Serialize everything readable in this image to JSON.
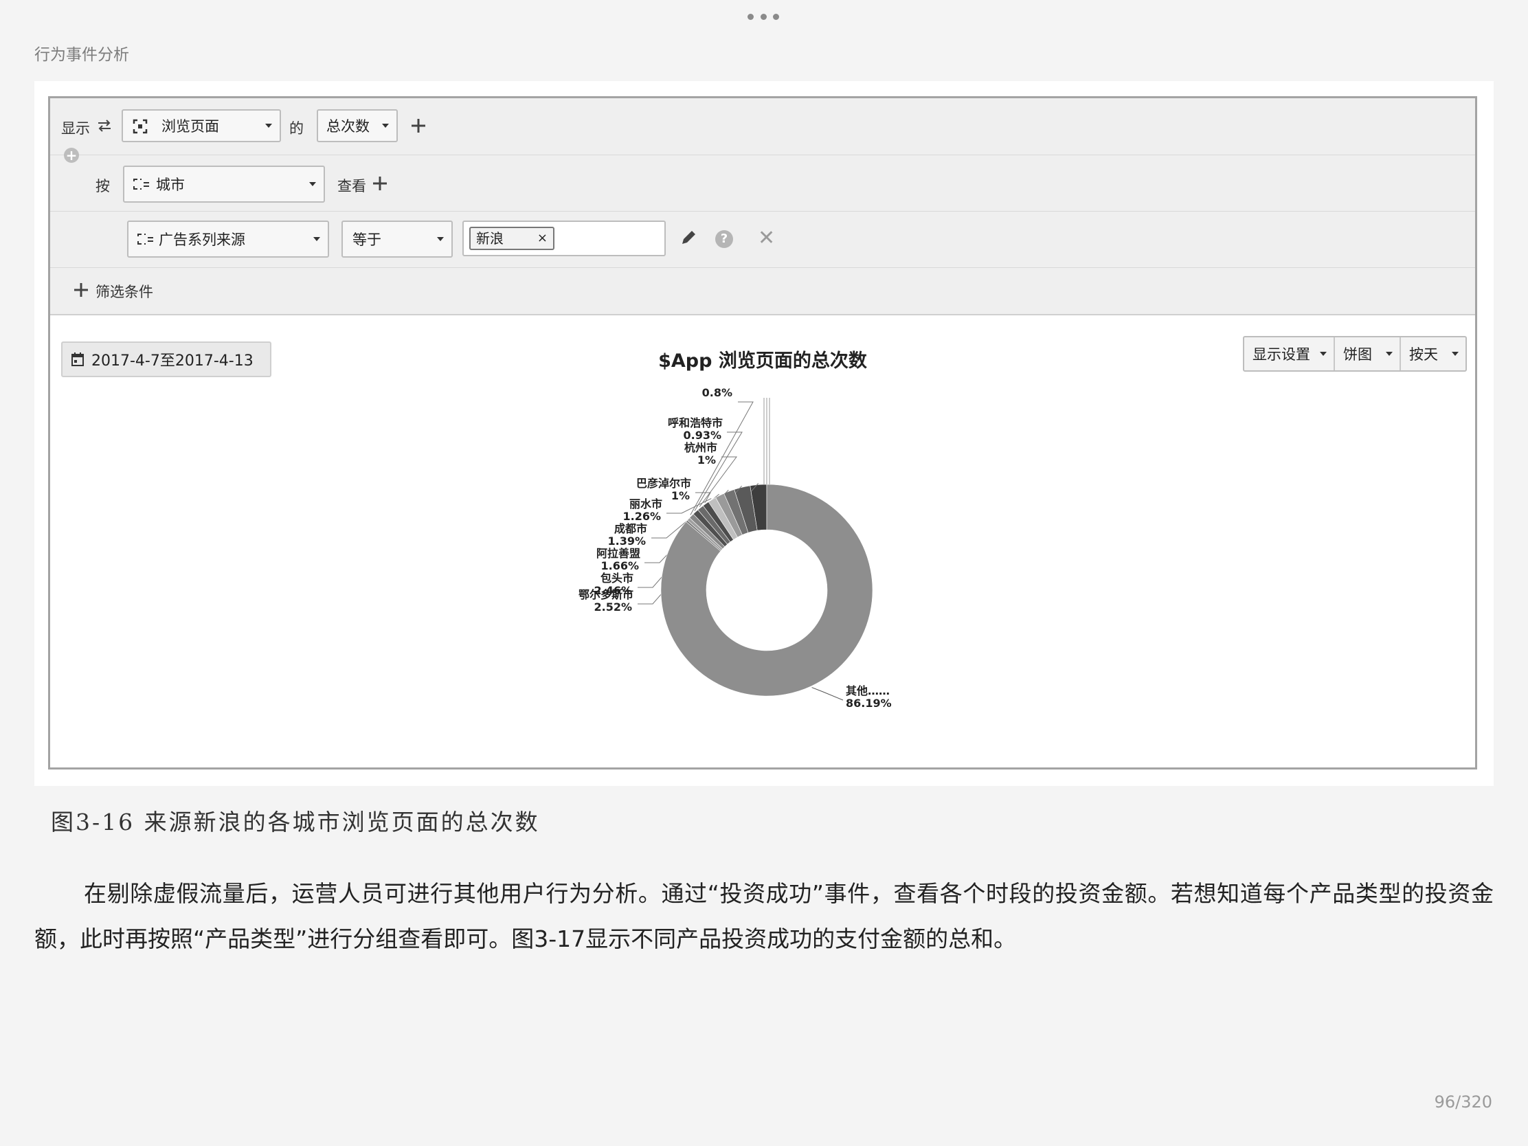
{
  "header": {
    "book_title": "行为事件分析"
  },
  "query": {
    "show_label": "显示",
    "event": "浏览页面",
    "of_label": "的",
    "metric": "总次数",
    "by_label": "按",
    "group_by": "城市",
    "view_label": "查看",
    "filter_property": "广告系列来源",
    "operator": "等于",
    "filter_value": "新浪",
    "add_filter_label": "筛选条件"
  },
  "toolbar": {
    "date_range": "2017-4-7至2017-4-13",
    "display_settings": "显示设置",
    "chart_type": "饼图",
    "granularity": "按天"
  },
  "chart_data": {
    "type": "pie",
    "donut": true,
    "title": "$App 浏览页面的总次数",
    "slices": [
      {
        "label": "鄂尔多斯市",
        "value": 2.52,
        "display": "2.52%"
      },
      {
        "label": "包头市",
        "value": 2.46,
        "display": "2.46%"
      },
      {
        "label": "阿拉善盟",
        "value": 1.66,
        "display": "1.66%"
      },
      {
        "label": "成都市",
        "value": 1.39,
        "display": "1.39%"
      },
      {
        "label": "丽水市",
        "value": 1.26,
        "display": "1.26%"
      },
      {
        "label": "巴彦淖尔市",
        "value": 1.0,
        "display": "1%"
      },
      {
        "label": "杭州市",
        "value": 1.0,
        "display": "1%"
      },
      {
        "label": "呼和浩特市",
        "value": 0.93,
        "display": "0.93%"
      },
      {
        "label": "",
        "value": 0.8,
        "display": "0.8%"
      },
      {
        "label": "",
        "value": 0.5,
        "display": ""
      },
      {
        "label": "",
        "value": 0.29,
        "display": ""
      },
      {
        "label": "其他……",
        "value": 86.19,
        "display": "86.19%"
      }
    ],
    "colors": [
      "#3e3e3e",
      "#5a5a5a",
      "#727272",
      "#9a9a9a",
      "#bfbfbf",
      "#4c4c4c",
      "#6a6a6a",
      "#505050",
      "#888888",
      "#a0a0a0",
      "#777777",
      "#8e8e8e"
    ]
  },
  "caption": "图3-16 来源新浪的各城市浏览页面的总次数",
  "paragraph": "在剔除虚假流量后，运营人员可进行其他用户行为分析。通过“投资成功”事件，查看各个时段的投资金额。若想知道每个产品类型的投资金额，此时再按照“产品类型”进行分组查看即可。图3-17显示不同产品投资成功的支付金额的总和。",
  "page_indicator": "96/320"
}
